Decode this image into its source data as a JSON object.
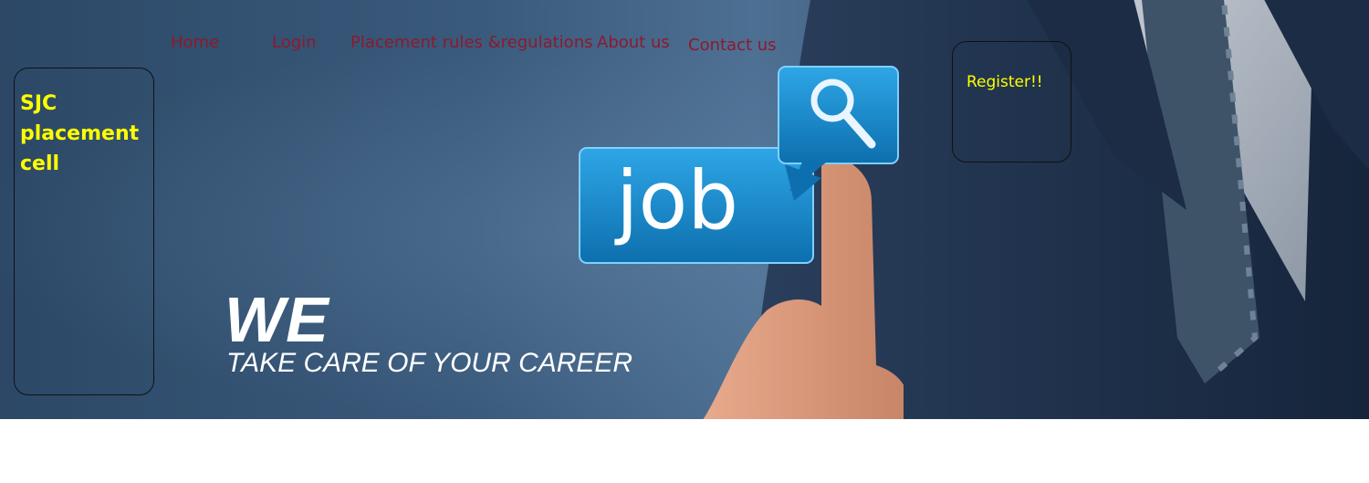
{
  "nav": {
    "items": [
      {
        "label": "Home"
      },
      {
        "label": "Login"
      },
      {
        "label": "Placement rules &regulations"
      },
      {
        "label": "About us"
      },
      {
        "label": "Contact us"
      }
    ]
  },
  "brand": {
    "title": "SJC placement cell"
  },
  "register": {
    "label": "Register!!"
  },
  "hero": {
    "headline": "WE",
    "tagline": "TAKE CARE OF YOUR CAREER",
    "graphic_text": "job",
    "graphic_icon": "magnifier-icon"
  },
  "colors": {
    "nav_text": "#8b1a2e",
    "highlight_text": "#ffff00",
    "hero_text": "#ffffff",
    "job_bubble": "#1a8bd0"
  }
}
